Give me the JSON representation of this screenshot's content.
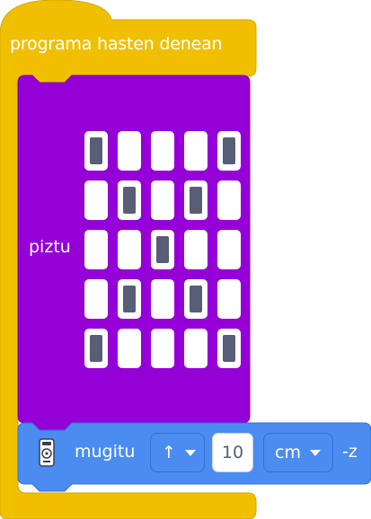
{
  "hat_block": {
    "label": "programa hasten denean",
    "color": "#f0c000"
  },
  "matrix_block": {
    "label": "piztu",
    "color": "#9400d6",
    "led_pattern": [
      [
        1,
        0,
        0,
        0,
        1
      ],
      [
        0,
        1,
        0,
        1,
        0
      ],
      [
        0,
        0,
        1,
        0,
        0
      ],
      [
        0,
        1,
        0,
        1,
        0
      ],
      [
        1,
        0,
        0,
        0,
        1
      ]
    ]
  },
  "move_block": {
    "icon": "remote-icon",
    "label": "mugitu",
    "direction": "↑",
    "distance": "10",
    "unit": "cm",
    "suffix": "-z",
    "color": "#4a8cf0"
  }
}
